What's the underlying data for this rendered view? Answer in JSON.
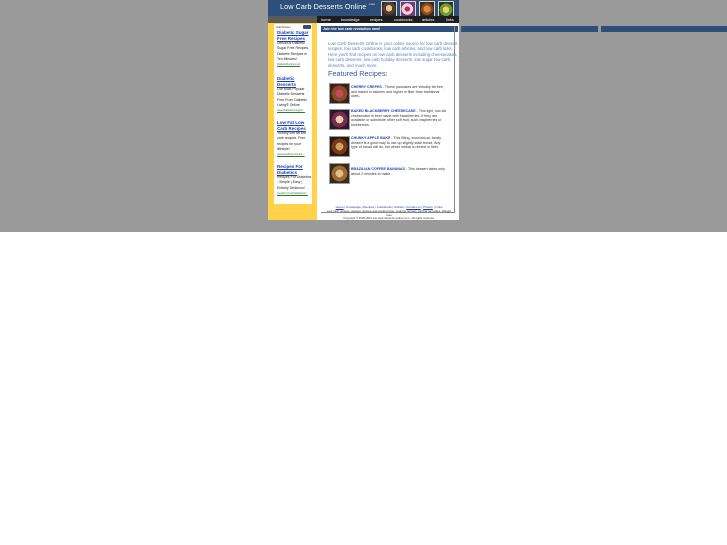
{
  "site": {
    "title": "Low Carb Desserts Online",
    "title_sup": ".com"
  },
  "nav": {
    "items": [
      "home",
      "knowledge",
      "recipes",
      "cookbooks",
      "articles",
      "links"
    ]
  },
  "ads": {
    "header": "AdChoices",
    "items": [
      {
        "title": "Diabetic Sugar Free Recipes",
        "body": "Delicious Diabetic Sugar Free Recipes. Diabetic Recipes in Ten Minutes!",
        "url": "DiabeticRecipes.net"
      },
      {
        "title": "Diabetic Desserts",
        "body": "Our Most Popular Diabetic Desserts Free From Diabetic Living® Online",
        "url": "www.DiabeticLivingOn..."
      },
      {
        "title": "Low Fat Low Carb Recipes",
        "body": "Yummy low fat low carb recipes. Free recipes for your lifestyle!",
        "url": "www.HealthyLowCarb..."
      },
      {
        "title": "Recipes For Diabetics",
        "body": "Recipes For Diabetics - Simple | Easy | Entirely Delicious!",
        "url": "CookForYourLifeDiabetic..."
      }
    ]
  },
  "main": {
    "bar_text": "Join the low carb revolution now!",
    "intro": "Low Carb Desserts Online is your online source for low carb dessert recipes, low carb cookbooks, low carb articles, and low carb links. Here you'll find recipes on low carb desserts including cheesecakes, low carb desserts, low carb holiday desserts, low sugar low carb desserts, and much more.",
    "featured_heading": "Featured Recipes:",
    "recipes": [
      {
        "name": "CHERRY CREPES",
        "desc": " - These pancakes are virtually fat free, and baked in calories and higher in fiber than traditional ones."
      },
      {
        "name": "BAKED BLACKBERRY CHEESECAKE",
        "desc": " - This light, low-fat cheesecake is best made with blackberries. If they are available or substitute other soft fruit, such raspberries or blueberries."
      },
      {
        "name": "CHUNKY APPLE BAKE",
        "desc": " - This filling, economical, family dessert is a good way to use up slightly stale bread. Any type of bread will do, but whole wheat is richest in fiber."
      },
      {
        "name": "BRAZILIAN COFFEE BANANAS",
        "desc": " - This dessert takes only about 2 minutes to make."
      }
    ]
  },
  "footer": {
    "links": [
      "Home",
      "Knowledge",
      "Recipes",
      "Cookbooks",
      "Articles",
      "Contact us",
      "Privacy",
      "Links"
    ],
    "disclaimer": "Low carb recipes, dessert recipes and cooking tips, cooking recipes, Herbal remedies, Weight loss",
    "copyright": "Copyright © 2005-2011 low-carb-desserts-online.com - All rights reserved."
  },
  "colors": {
    "header": "#2d4f7a",
    "sidebar": "#ffd24a",
    "link": "#1a3fb0",
    "heading": "#2d5a9a"
  }
}
